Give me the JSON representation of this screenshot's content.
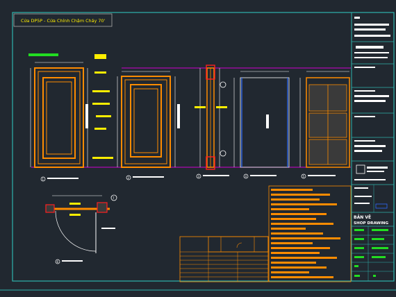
{
  "drawing": {
    "title": "Cửa DP5P - Cửa Chính Chậm Cháy 70'",
    "callouts": [
      "1",
      "2",
      "3",
      "4",
      "5",
      "6",
      "7"
    ],
    "title_block": {
      "sheet_name_line1": "BẢN VẼ",
      "sheet_name_line2": "SHOP DRAWING"
    }
  },
  "colors": {
    "background": "#212830",
    "frame": "#2fb3ad",
    "door_outline": "#ff8c00",
    "dimension": "#ffffff",
    "highlight": "#ffee00",
    "label_green": "#22dd22",
    "magenta_line": "#d100d1",
    "blue_line": "#2d6bff",
    "red_mark": "#ff2020"
  }
}
